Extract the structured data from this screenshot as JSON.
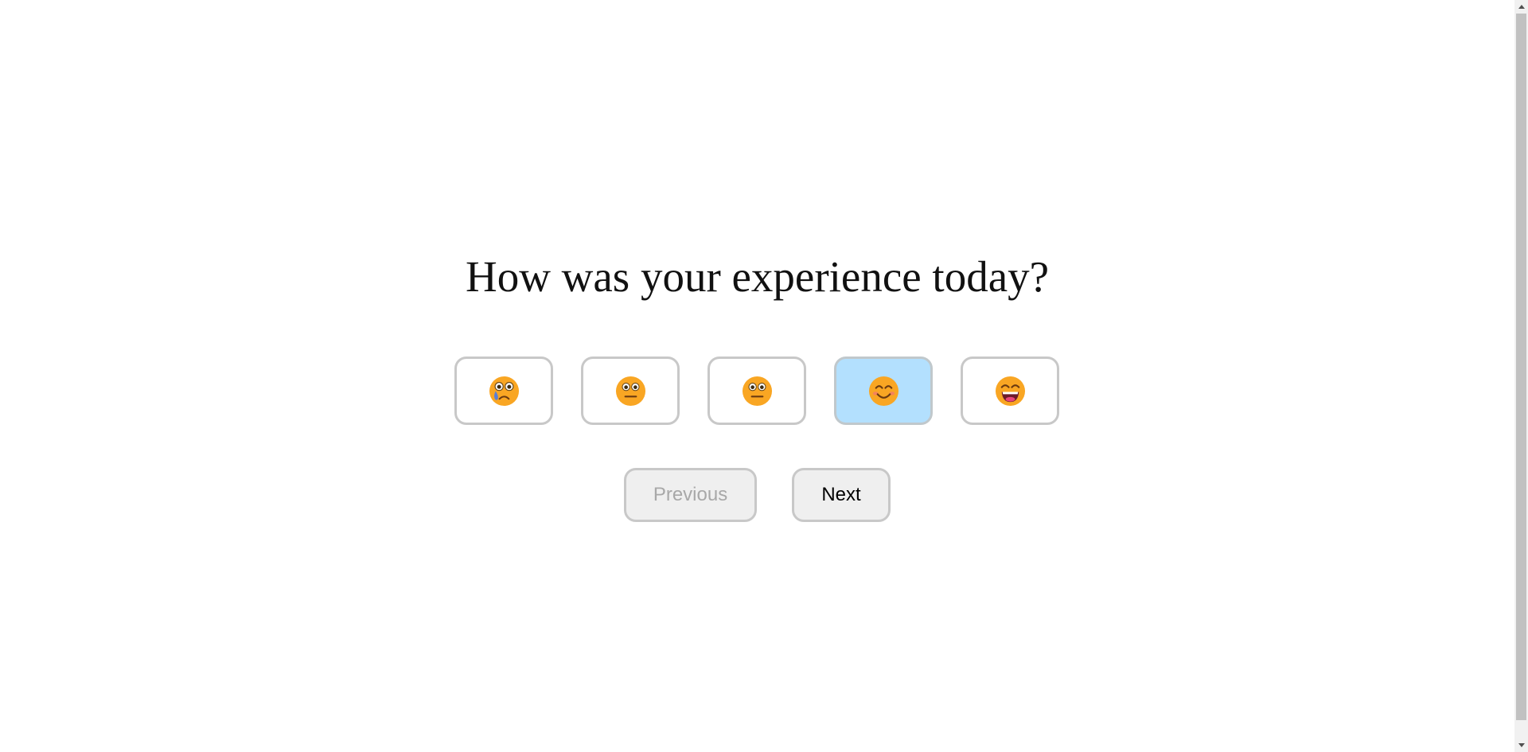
{
  "survey": {
    "question": "How was your experience today?",
    "options": [
      {
        "icon": "crying-face-icon",
        "selected": false
      },
      {
        "icon": "neutral-face-icon",
        "selected": false
      },
      {
        "icon": "neutral-face-icon",
        "selected": false
      },
      {
        "icon": "smiling-face-icon",
        "selected": true
      },
      {
        "icon": "grinning-face-icon",
        "selected": false
      }
    ],
    "selected_index": 3
  },
  "navigation": {
    "previous_label": "Previous",
    "next_label": "Next",
    "previous_disabled": true
  },
  "colors": {
    "selected_background": "#b3e0fe",
    "border": "#c8c8c8",
    "button_background": "#efefef",
    "face": "#f9a623",
    "disabled_text": "#a8a8a8"
  }
}
